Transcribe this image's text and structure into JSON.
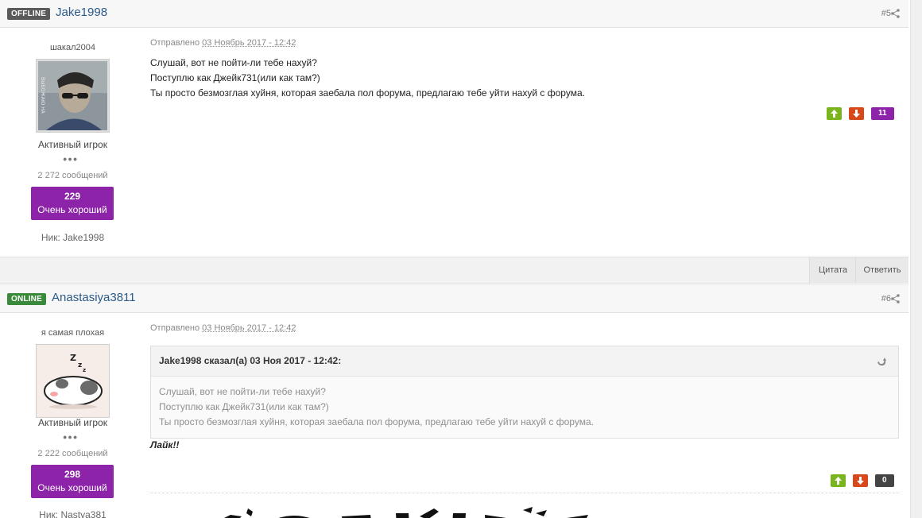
{
  "posts": [
    {
      "status": "OFFLINE",
      "author": "Jake1998",
      "post_number": "#5",
      "user_title": "шакал2004",
      "rank": "Активный игрок",
      "pips": "●●●",
      "posts_count": "2 272 сообщений",
      "reputation": "229",
      "reputation_label": "Очень хороший",
      "nick": "Ник: Jake1998",
      "date_prefix": "Отправлено",
      "date": "03 Ноябрь 2017 - 12:42",
      "lines": [
        "Слушай, вот не пойти-ли тебе нахуй?",
        "Поступлю как Джейк731(или как там?)",
        "Ты просто безмозглая хуйня, которая заебала пол форума, предлагаю тебе уйти нахуй с форума."
      ],
      "vote_count": "11",
      "vote_count_color": "#8c23a8"
    },
    {
      "status": "ONLINE",
      "author": "Anastasiya3811",
      "post_number": "#6",
      "user_title": "я самая плохая",
      "rank": "Активный игрок",
      "pips": "●●●",
      "posts_count": "2 222 сообщений",
      "reputation": "298",
      "reputation_label": "Очень хороший",
      "nick": "Ник: Nastya381",
      "date_prefix": "Отправлено",
      "date": "03 Ноябрь 2017 - 12:42",
      "quote": {
        "citation": "Jake1998 сказал(а) 03 Ноя 2017 - 12:42:",
        "lines": [
          "Слушай, вот не пойти-ли тебе нахуй?",
          "Поступлю как Джейк731(или как там?)",
          "Ты просто безмозглая хуйня, которая заебала пол форума, предлагаю тебе уйти нахуй с форума."
        ]
      },
      "reply_text": "Лайк!!",
      "vote_count": "0",
      "vote_count_color": "#444444"
    }
  ],
  "actions": {
    "quote_label": "Цитата",
    "reply_label": "Ответить"
  },
  "colors": {
    "accent_link": "#2a5a88",
    "reputation_bg": "#8c23a8",
    "vote_up": "#7ab51d",
    "vote_down": "#d8481a",
    "online": "#3b8a3b",
    "offline": "#5a5a5a"
  }
}
